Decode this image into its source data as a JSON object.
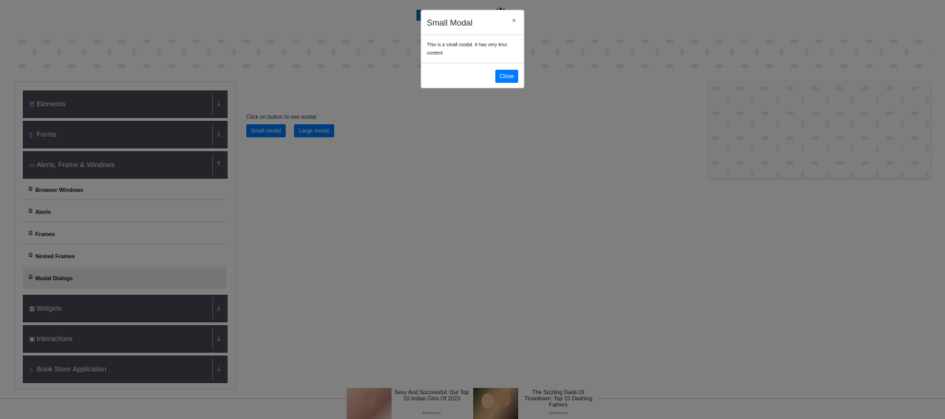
{
  "header": {
    "logo_icon": "gear-icon"
  },
  "sidebar": {
    "groups": [
      {
        "label": "Elements",
        "icon": "menu-icon",
        "arrow": "⤓"
      },
      {
        "label": "Forms",
        "icon": "form-icon",
        "arrow": "⤓"
      },
      {
        "label": "Alerts, Frame & Windows",
        "icon": "window-icon",
        "arrow": "⤒"
      },
      {
        "label": "Widgets",
        "icon": "grid-icon",
        "arrow": "⤓"
      },
      {
        "label": "Interactions",
        "icon": "interaction-icon",
        "arrow": "⤓"
      },
      {
        "label": "Book Store Application",
        "icon": "book-icon",
        "arrow": "⤓"
      }
    ],
    "subitems": [
      {
        "label": "Browser Windows"
      },
      {
        "label": "Alerts"
      },
      {
        "label": "Frames"
      },
      {
        "label": "Nested Frames"
      },
      {
        "label": "Modal Dialogs",
        "active": true
      }
    ]
  },
  "main": {
    "hint": "Click on button to see modal",
    "small_modal_button": "Small modal",
    "large_modal_button": "Large modal"
  },
  "modal": {
    "title": "Small Modal",
    "close_x": "×",
    "body": "This is a small modal. It has very less content",
    "close_button": "Close"
  },
  "ads": [
    {
      "title": "Sexy And Successful: Our Top 10 Indian Girls Of 2023",
      "source": "Brainberries"
    },
    {
      "title": "The Sizzling Dads Of Tinseltown: Top 15 Dashing Fathers",
      "source": "Brainberries"
    }
  ],
  "colors": {
    "accent": "#007bff",
    "sidebar_group_bg": "#474b57",
    "overlay": "rgba(0,0,0,0.5)"
  }
}
